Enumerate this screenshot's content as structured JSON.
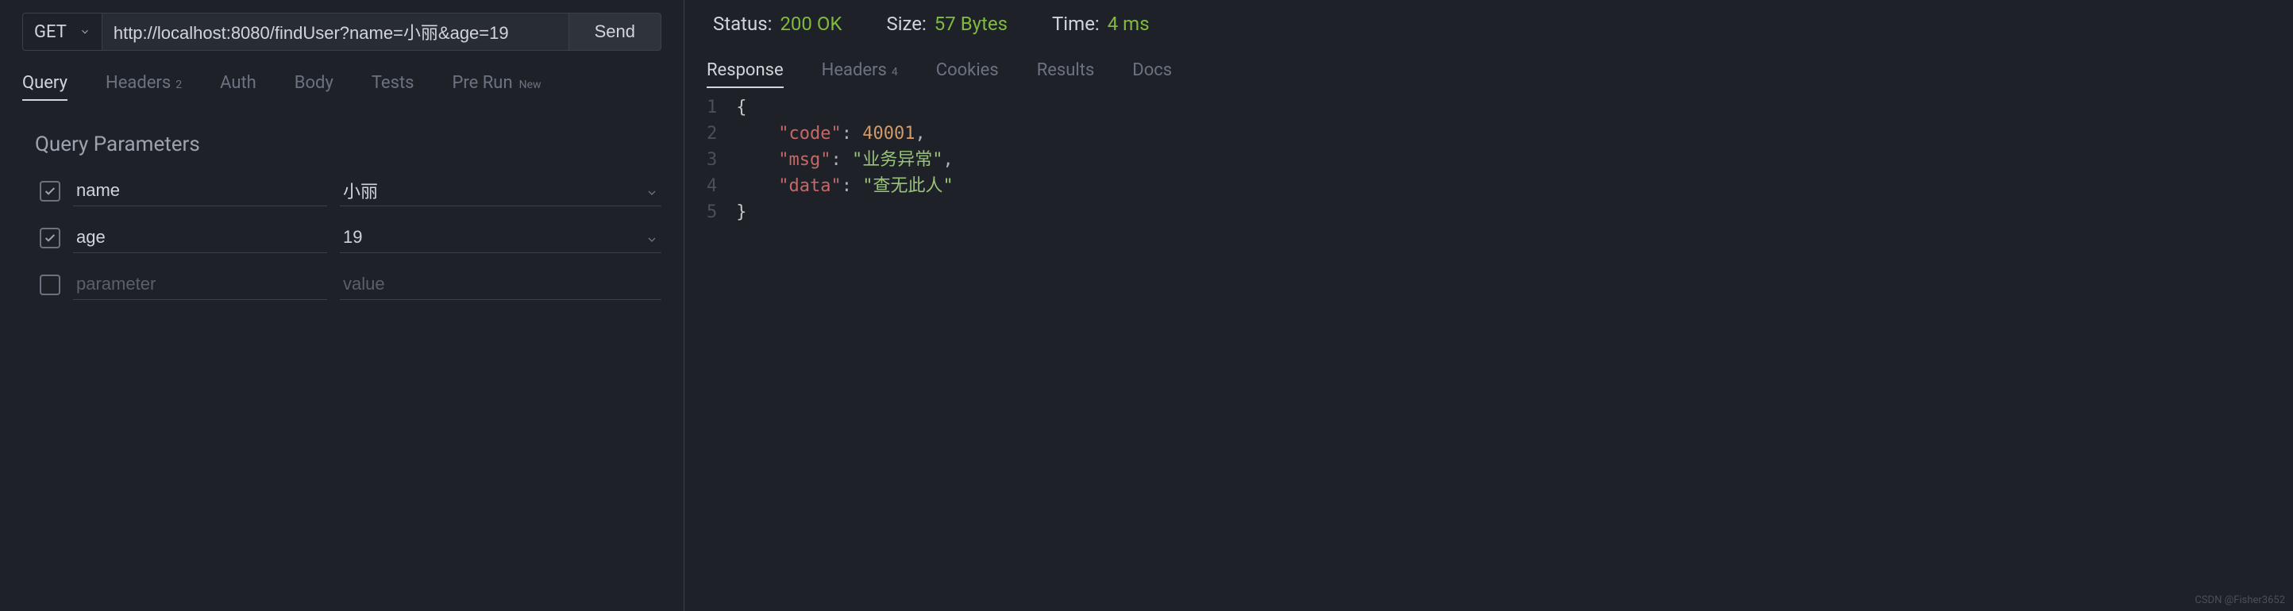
{
  "request": {
    "method": "GET",
    "url": "http://localhost:8080/findUser?name=小丽&age=19",
    "send_label": "Send"
  },
  "left_tabs": {
    "items": [
      {
        "label": "Query",
        "active": true
      },
      {
        "label": "Headers",
        "badge": "2"
      },
      {
        "label": "Auth"
      },
      {
        "label": "Body"
      },
      {
        "label": "Tests"
      },
      {
        "label": "Pre Run",
        "new": "New"
      }
    ]
  },
  "query_section": {
    "title": "Query Parameters",
    "params": [
      {
        "checked": true,
        "name": "name",
        "value": "小丽"
      },
      {
        "checked": true,
        "name": "age",
        "value": "19"
      },
      {
        "checked": false,
        "name": "",
        "value": "",
        "name_placeholder": "parameter",
        "value_placeholder": "value"
      }
    ]
  },
  "status": {
    "status_label": "Status:",
    "status_value": "200 OK",
    "size_label": "Size:",
    "size_value": "57 Bytes",
    "time_label": "Time:",
    "time_value": "4 ms"
  },
  "right_tabs": {
    "items": [
      {
        "label": "Response",
        "active": true
      },
      {
        "label": "Headers",
        "badge": "4"
      },
      {
        "label": "Cookies"
      },
      {
        "label": "Results"
      },
      {
        "label": "Docs"
      }
    ]
  },
  "response_body": {
    "code": 40001,
    "msg": "业务异常",
    "data": "查无此人"
  },
  "response_lines": [
    {
      "n": "1",
      "indent": "",
      "brace": "{"
    },
    {
      "n": "2",
      "indent": "    ",
      "key": "\"code\"",
      "colon": ": ",
      "value": "40001",
      "comma": ",",
      "vtype": "number"
    },
    {
      "n": "3",
      "indent": "    ",
      "key": "\"msg\"",
      "colon": ": ",
      "value": "\"业务异常\"",
      "comma": ",",
      "vtype": "string"
    },
    {
      "n": "4",
      "indent": "    ",
      "key": "\"data\"",
      "colon": ": ",
      "value": "\"查无此人\"",
      "comma": "",
      "vtype": "string"
    },
    {
      "n": "5",
      "indent": "",
      "brace": "}"
    }
  ],
  "watermark": "CSDN @Fisher3652"
}
